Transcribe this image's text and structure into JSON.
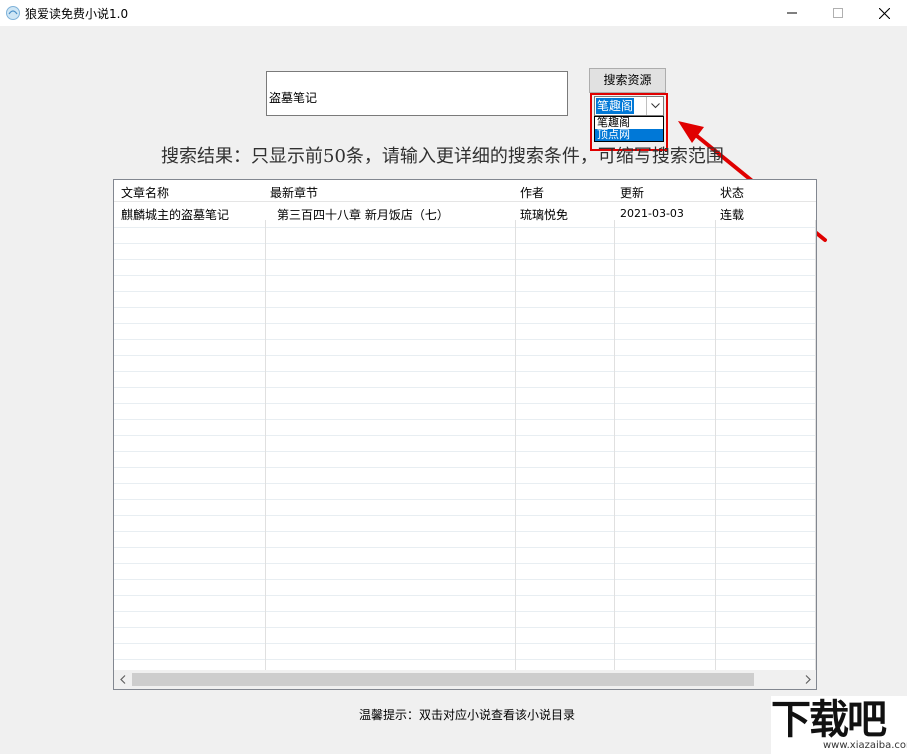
{
  "window": {
    "title": "狼爱读免费小说1.0"
  },
  "search": {
    "query": "盗墓笔记",
    "button_label": "搜索资源",
    "source_selected": "笔趣阁",
    "source_options": [
      "笔趣阁",
      "顶点网"
    ],
    "source_highlighted": "顶点网"
  },
  "result_label": "搜索结果：只显示前50条，请输入更详细的搜索条件，可缩写搜索范围",
  "table": {
    "columns": [
      "文章名称",
      "最新章节",
      "作者",
      "更新",
      "状态"
    ],
    "rows": [
      {
        "name": "麒麟城主的盗墓笔记",
        "chapter": "第三百四十八章 新月饭店（七）",
        "author": "琉璃悦免",
        "updated": "2021-03-03",
        "status": "连载"
      }
    ]
  },
  "hint": "温馨提示：双击对应小说查看该小说目录",
  "watermark": {
    "logo": "下载吧",
    "url": "www.xiazaiba.com"
  },
  "colors": {
    "accent": "#0078d7",
    "annotation": "#e00000"
  }
}
